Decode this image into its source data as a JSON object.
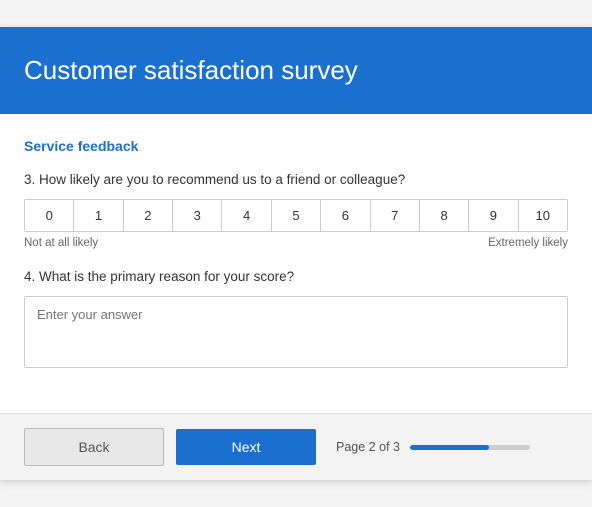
{
  "header": {
    "title": "Customer satisfaction survey"
  },
  "section": {
    "label": "Service feedback"
  },
  "questions": [
    {
      "number": "3.",
      "text": "How likely are you to recommend us to a friend or colleague?",
      "type": "likert",
      "scale": [
        0,
        1,
        2,
        3,
        4,
        5,
        6,
        7,
        8,
        9,
        10
      ],
      "label_left": "Not at all likely",
      "label_right": "Extremely likely"
    },
    {
      "number": "4.",
      "text": "What is the primary reason for your score?",
      "type": "textarea",
      "placeholder": "Enter your answer"
    }
  ],
  "footer": {
    "back_label": "Back",
    "next_label": "Next",
    "page_text": "Page 2 of 3",
    "progress_percent": 66
  }
}
